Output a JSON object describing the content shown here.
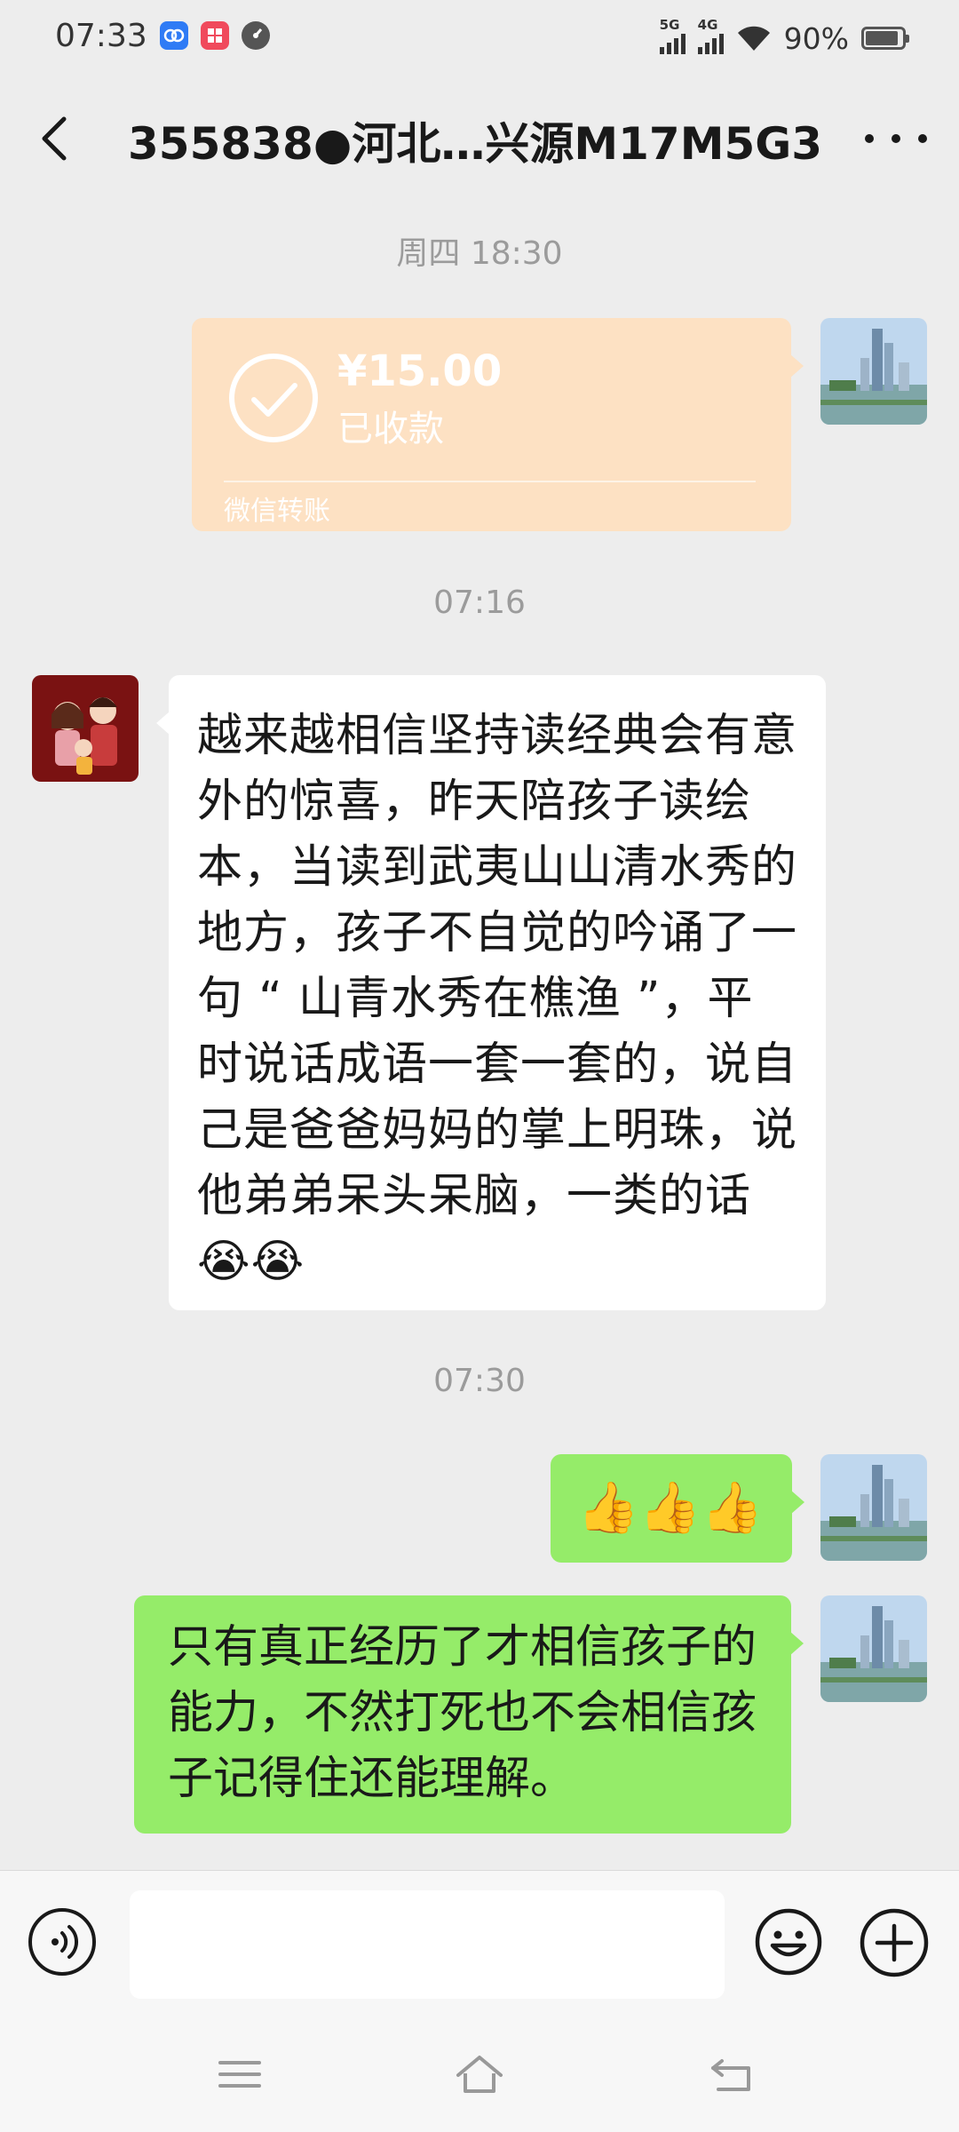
{
  "status_bar": {
    "time": "07:33",
    "network_5g": "5G",
    "network_4g": "4G",
    "battery_percent": "90%",
    "battery_level": 0.9
  },
  "nav": {
    "title": "355838●河北…兴源M17M5G3"
  },
  "messages": [
    {
      "type": "timestamp",
      "text": "周四 18:30"
    },
    {
      "type": "transfer",
      "side": "right",
      "amount": "¥15.00",
      "state": "已收款",
      "footer": "微信转账"
    },
    {
      "type": "timestamp",
      "text": "07:16"
    },
    {
      "type": "text",
      "side": "left",
      "text": "越来越相信坚持读经典会有意外的惊喜，昨天陪孩子读绘本，当读到武夷山山清水秀的地方，孩子不自觉的吟诵了一句 “ 山青水秀在樵渔 ”，平时说话成语一套一套的，说自己是爸爸妈妈的掌上明珠，说他弟弟呆头呆脑，一类的话😭😭"
    },
    {
      "type": "timestamp",
      "text": "07:30"
    },
    {
      "type": "text",
      "side": "right",
      "text": "👍👍👍"
    },
    {
      "type": "text",
      "side": "right",
      "text": "只有真正经历了才相信孩子的能力，不然打死也不会相信孩子记得住还能理解。"
    }
  ],
  "input": {
    "value": ""
  },
  "colors": {
    "background": "#EDEDED",
    "outgoing_bubble": "#95EC69",
    "incoming_bubble": "#FFFFFF",
    "transfer_card": "#FDE1C3",
    "timestamp": "#9B9B9B"
  },
  "icons": {
    "back": "back-arrow-icon",
    "more": "more-dots-icon",
    "voice": "voice-icon",
    "emoji": "emoji-icon",
    "add": "plus-icon",
    "transfer": "check-circle-icon",
    "sys_menu": "menu-icon",
    "sys_home": "home-icon",
    "sys_back": "back-icon"
  }
}
